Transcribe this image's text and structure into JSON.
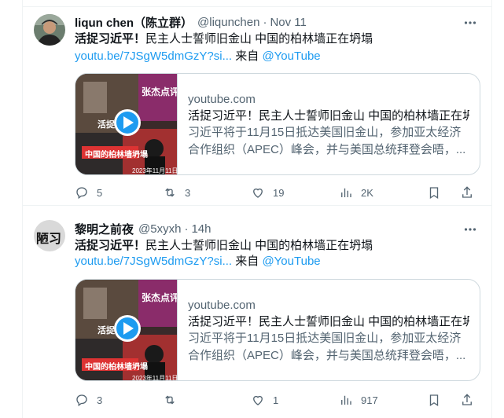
{
  "tweets": [
    {
      "display_name": "liqun chen（陈立群）",
      "handle": "@liqunchen",
      "separator": "·",
      "time": "Nov 11",
      "text_bold": "活捉习近平！",
      "text_rest": "民主人士誓师旧金山 中国的柏林墙正在坍塌",
      "link_text": "youtu.be/7JSgW5dmGzY?si...",
      "via_text": "来自",
      "mention": "@YouTube",
      "card": {
        "domain": "youtube.com",
        "title": "活捉习近平！民主人士誓师旧金山 中国的柏林墙正在坍塌",
        "desc_line1": "习近平将于11月15日抵达美国旧金山，参加亚太经济",
        "desc_line2": "合作组织（APEC）峰会，并与美国总统拜登会晤，...",
        "thumb_badge": "张杰点评",
        "thumb_caption": "中国的柏林墙坍塌",
        "thumb_date": "2023年11月11日",
        "thumb_side": "活捉"
      },
      "replies": "5",
      "retweets": "3",
      "likes": "19",
      "views": "2K"
    },
    {
      "display_name": "黎明之前夜",
      "handle": "@5xyxh",
      "separator": "·",
      "time": "14h",
      "avatar_text": "陋习",
      "text_bold": "活捉习近平！",
      "text_rest": "民主人士誓师旧金山 中国的柏林墙正在坍塌",
      "link_text": "youtu.be/7JSgW5dmGzY?si...",
      "via_text": "来自",
      "mention": "@YouTube",
      "card": {
        "domain": "youtube.com",
        "title": "活捉习近平！民主人士誓师旧金山 中国的柏林墙正在坍塌",
        "desc_line1": "习近平将于11月15日抵达美国旧金山，参加亚太经济",
        "desc_line2": "合作组织（APEC）峰会，并与美国总统拜登会晤，...",
        "thumb_badge": "张杰点评",
        "thumb_caption": "中国的柏林墙坍塌",
        "thumb_date": "2023年11月11日",
        "thumb_side": "活捉"
      },
      "replies": "3",
      "retweets": "",
      "likes": "1",
      "views": "917"
    }
  ],
  "colors": {
    "link": "#1d9bf0",
    "secondary_text": "#536471",
    "border": "#cfd9de",
    "divider": "#eff3f4"
  }
}
